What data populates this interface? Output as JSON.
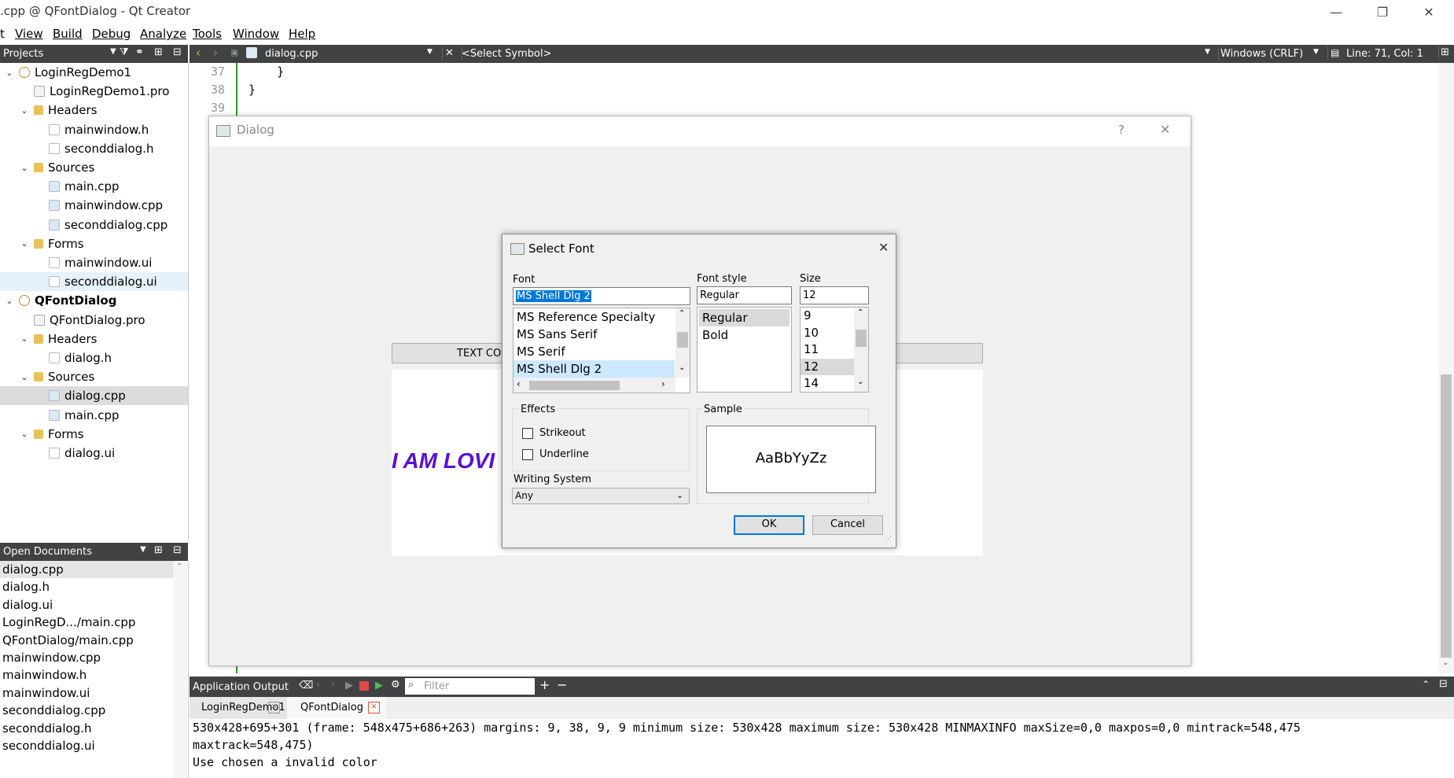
{
  "window": {
    "title": ".cpp @ QFontDialog - Qt Creator",
    "minimize": "—",
    "restore": "❐",
    "close": "✕"
  },
  "menu": [
    "t",
    "View",
    "Build",
    "Debug",
    "Analyze",
    "Tools",
    "Window",
    "Help"
  ],
  "projects_pane": {
    "title": "Projects",
    "tree": [
      {
        "label": "LoginRegDemo1",
        "level": 0,
        "caret": "v",
        "icon": "project-icon",
        "bold": false
      },
      {
        "label": "LoginRegDemo1.pro",
        "level": 1,
        "caret": "",
        "icon": "pro-file-icon"
      },
      {
        "label": "Headers",
        "level": 1,
        "caret": "v",
        "icon": "headers-folder-icon"
      },
      {
        "label": "mainwindow.h",
        "level": 2,
        "caret": "",
        "icon": "header-file-icon"
      },
      {
        "label": "seconddialog.h",
        "level": 2,
        "caret": "",
        "icon": "header-file-icon"
      },
      {
        "label": "Sources",
        "level": 1,
        "caret": "v",
        "icon": "sources-folder-icon"
      },
      {
        "label": "main.cpp",
        "level": 2,
        "caret": "",
        "icon": "cpp-file-icon"
      },
      {
        "label": "mainwindow.cpp",
        "level": 2,
        "caret": "",
        "icon": "cpp-file-icon"
      },
      {
        "label": "seconddialog.cpp",
        "level": 2,
        "caret": "",
        "icon": "cpp-file-icon"
      },
      {
        "label": "Forms",
        "level": 1,
        "caret": "v",
        "icon": "forms-folder-icon"
      },
      {
        "label": "mainwindow.ui",
        "level": 2,
        "caret": "",
        "icon": "ui-file-icon"
      },
      {
        "label": "seconddialog.ui",
        "level": 2,
        "caret": "",
        "icon": "ui-file-icon",
        "state": "hover"
      },
      {
        "label": "QFontDialog",
        "level": 0,
        "caret": "v",
        "icon": "project-icon",
        "bold": true
      },
      {
        "label": "QFontDialog.pro",
        "level": 1,
        "caret": "",
        "icon": "pro-file-icon"
      },
      {
        "label": "Headers",
        "level": 1,
        "caret": "v",
        "icon": "headers-folder-icon"
      },
      {
        "label": "dialog.h",
        "level": 2,
        "caret": "",
        "icon": "header-file-icon"
      },
      {
        "label": "Sources",
        "level": 1,
        "caret": "v",
        "icon": "sources-folder-icon"
      },
      {
        "label": "dialog.cpp",
        "level": 2,
        "caret": "",
        "icon": "cpp-file-icon",
        "state": "current"
      },
      {
        "label": "main.cpp",
        "level": 2,
        "caret": "",
        "icon": "cpp-file-icon"
      },
      {
        "label": "Forms",
        "level": 1,
        "caret": "v",
        "icon": "forms-folder-icon"
      },
      {
        "label": "dialog.ui",
        "level": 2,
        "caret": "",
        "icon": "ui-file-icon"
      }
    ]
  },
  "open_documents": {
    "title": "Open Documents",
    "items": [
      "dialog.cpp",
      "dialog.h",
      "dialog.ui",
      "LoginRegD.../main.cpp",
      "QFontDialog/main.cpp",
      "mainwindow.cpp",
      "mainwindow.h",
      "mainwindow.ui",
      "seconddialog.cpp",
      "seconddialog.h",
      "seconddialog.ui"
    ]
  },
  "editor_toolbar": {
    "file": "dialog.cpp",
    "symbol": "<Select Symbol>",
    "line_ending": "Windows (CRLF)",
    "position": "Line: 71, Col: 1"
  },
  "editor": {
    "lines": [
      {
        "no": "37",
        "code": "    }"
      },
      {
        "no": "38",
        "code": "}"
      },
      {
        "no": "39",
        "code": ""
      }
    ]
  },
  "dialog": {
    "title": "Dialog",
    "help": "?",
    "close": "✕",
    "text_color_button": "TEXT COL",
    "preview_text": "I AM LOVI",
    "preview_color": "#5a0fd6"
  },
  "font_dialog": {
    "title": "Select Font",
    "close": "✕",
    "font_label": "Font",
    "font_value": "MS Shell Dlg 2",
    "font_list": [
      "MS Reference Specialty",
      "MS Sans Serif",
      "MS Serif",
      "MS Shell Dlg 2"
    ],
    "style_label": "Font style",
    "style_value": "Regular",
    "style_list": [
      "Regular",
      "Bold"
    ],
    "size_label": "Size",
    "size_value": "12",
    "size_list": [
      "9",
      "10",
      "11",
      "12",
      "14"
    ],
    "effects_label": "Effects",
    "strikeout": "Strikeout",
    "underline": "Underline",
    "writing_system_label": "Writing System",
    "writing_system_value": "Any",
    "sample_label": "Sample",
    "sample_text": "AaBbYyZz",
    "ok": "OK",
    "cancel": "Cancel"
  },
  "output_pane": {
    "title": "Application Output",
    "filter_placeholder": "Filter",
    "tabs": [
      "LoginRegDemo1",
      "QFontDialog"
    ],
    "lines": [
      "530x428+695+301 (frame: 548x475+686+263) margins: 9, 38, 9, 9 minimum size: 530x428 maximum size: 530x428 MINMAXINFO maxSize=0,0 maxpos=0,0 mintrack=548,475",
      "maxtrack=548,475)",
      "Use chosen a invalid color"
    ]
  },
  "colors": {
    "dark_bar": "#404244",
    "accent": "#0078d7",
    "selection": "#cce8ff",
    "gutter_marker": "#2b9a2b"
  }
}
